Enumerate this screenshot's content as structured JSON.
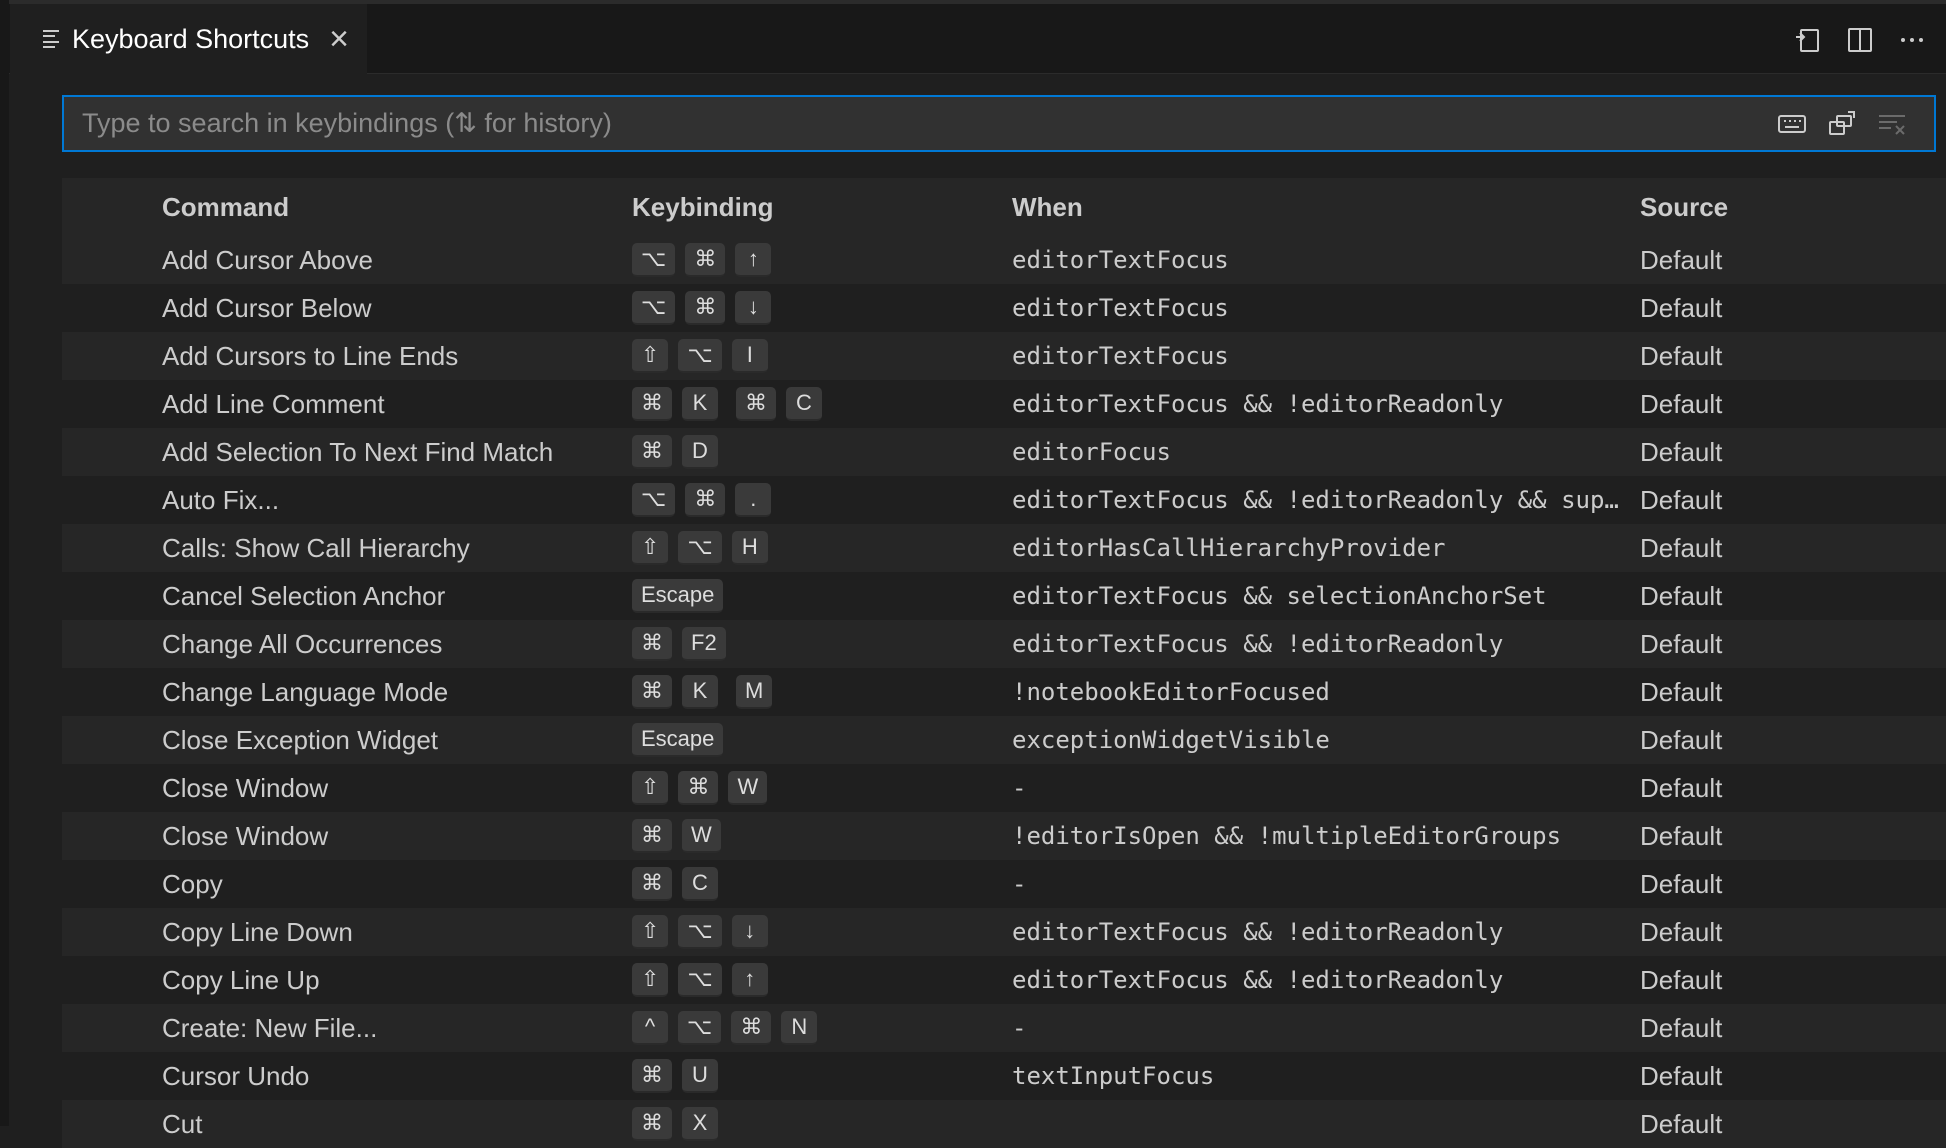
{
  "tab": {
    "title": "Keyboard Shortcuts",
    "close": "×"
  },
  "search": {
    "placeholder": "Type to search in keybindings (⇅ for history)",
    "value": ""
  },
  "columns": {
    "command": "Command",
    "keybinding": "Keybinding",
    "when": "When",
    "source": "Source"
  },
  "rows": [
    {
      "command": "Add Cursor Above",
      "keys": [
        "⌥",
        "⌘",
        "↑"
      ],
      "when": "editorTextFocus",
      "source": "Default"
    },
    {
      "command": "Add Cursor Below",
      "keys": [
        "⌥",
        "⌘",
        "↓"
      ],
      "when": "editorTextFocus",
      "source": "Default"
    },
    {
      "command": "Add Cursors to Line Ends",
      "keys": [
        "⇧",
        "⌥",
        "I"
      ],
      "when": "editorTextFocus",
      "source": "Default"
    },
    {
      "command": "Add Line Comment",
      "keys": [
        "⌘",
        "K"
      ],
      "keys2": [
        "⌘",
        "C"
      ],
      "when": "editorTextFocus && !editorReadonly",
      "source": "Default"
    },
    {
      "command": "Add Selection To Next Find Match",
      "keys": [
        "⌘",
        "D"
      ],
      "when": "editorFocus",
      "source": "Default"
    },
    {
      "command": "Auto Fix...",
      "keys": [
        "⌥",
        "⌘",
        "."
      ],
      "when": "editorTextFocus && !editorReadonly && supp…",
      "source": "Default"
    },
    {
      "command": "Calls: Show Call Hierarchy",
      "keys": [
        "⇧",
        "⌥",
        "H"
      ],
      "when": "editorHasCallHierarchyProvider",
      "source": "Default"
    },
    {
      "command": "Cancel Selection Anchor",
      "keys": [
        "Escape"
      ],
      "when": "editorTextFocus && selectionAnchorSet",
      "source": "Default"
    },
    {
      "command": "Change All Occurrences",
      "keys": [
        "⌘",
        "F2"
      ],
      "when": "editorTextFocus && !editorReadonly",
      "source": "Default"
    },
    {
      "command": "Change Language Mode",
      "keys": [
        "⌘",
        "K"
      ],
      "keys2": [
        "M"
      ],
      "when": "!notebookEditorFocused",
      "source": "Default"
    },
    {
      "command": "Close Exception Widget",
      "keys": [
        "Escape"
      ],
      "when": "exceptionWidgetVisible",
      "source": "Default"
    },
    {
      "command": "Close Window",
      "keys": [
        "⇧",
        "⌘",
        "W"
      ],
      "when": "-",
      "source": "Default"
    },
    {
      "command": "Close Window",
      "keys": [
        "⌘",
        "W"
      ],
      "when": "!editorIsOpen && !multipleEditorGroups",
      "source": "Default"
    },
    {
      "command": "Copy",
      "keys": [
        "⌘",
        "C"
      ],
      "when": "-",
      "source": "Default"
    },
    {
      "command": "Copy Line Down",
      "keys": [
        "⇧",
        "⌥",
        "↓"
      ],
      "when": "editorTextFocus && !editorReadonly",
      "source": "Default"
    },
    {
      "command": "Copy Line Up",
      "keys": [
        "⇧",
        "⌥",
        "↑"
      ],
      "when": "editorTextFocus && !editorReadonly",
      "source": "Default"
    },
    {
      "command": "Create: New File...",
      "keys": [
        "^",
        "⌥",
        "⌘",
        "N"
      ],
      "when": "-",
      "source": "Default"
    },
    {
      "command": "Cursor Undo",
      "keys": [
        "⌘",
        "U"
      ],
      "when": "textInputFocus",
      "source": "Default"
    },
    {
      "command": "Cut",
      "keys": [
        "⌘",
        "X"
      ],
      "when": "",
      "source": "Default"
    }
  ],
  "icons": {
    "tab": "keyboard-shortcuts-icon",
    "toolbar": [
      "open-json-icon",
      "split-editor-icon",
      "more-actions-icon"
    ],
    "search": [
      "record-keys-icon",
      "sort-by-precedence-icon",
      "clear-search-icon"
    ]
  },
  "colors": {
    "accent": "#0078d4",
    "background": "#1f1f1f",
    "stripe": "#262626"
  }
}
